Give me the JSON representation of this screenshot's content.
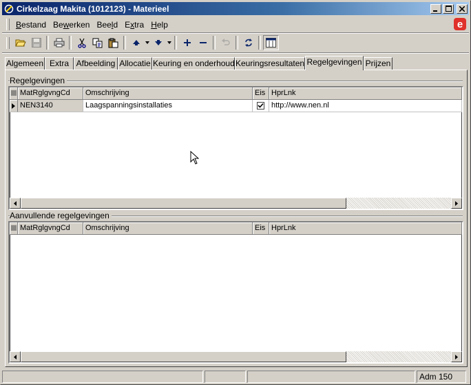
{
  "window": {
    "title": "Cirkelzaag Makita (1012123) - Materieel",
    "controls": {
      "minimize": "_",
      "maximize": "□",
      "close": "×"
    }
  },
  "menu": {
    "items": [
      {
        "label": "Bestand",
        "accel": "B"
      },
      {
        "label": "Bewerken",
        "accel": "w"
      },
      {
        "label": "Beeld",
        "accel": "l"
      },
      {
        "label": "Extra",
        "accel": "x"
      },
      {
        "label": "Help",
        "accel": "H"
      }
    ],
    "brand_glyph": "e"
  },
  "toolbar": {
    "buttons": [
      "open-folder-icon",
      "save-icon",
      "print-icon",
      "cut-icon",
      "copy-icon",
      "paste-icon",
      "navigate-up-icon",
      "navigate-down-icon",
      "add-icon",
      "remove-icon",
      "undo-icon",
      "refresh-icon",
      "layout-icon"
    ]
  },
  "tabs": {
    "items": [
      "Algemeen",
      "Extra",
      "Afbeelding",
      "Allocatie",
      "Keuring en onderhoud",
      "Keuringsresultaten",
      "Regelgevingen",
      "Prijzen"
    ],
    "active": "Regelgevingen"
  },
  "regelgevingen": {
    "title": "Regelgevingen",
    "columns": [
      "MatRglgvngCd",
      "Omschrijving",
      "Eis",
      "HprLnk"
    ],
    "rows": [
      {
        "code": "NEN3140",
        "omschrijving": "Laagspanningsinstallaties",
        "eis": true,
        "link": "http://www.nen.nl"
      }
    ]
  },
  "aanvullende": {
    "title": "Aanvullende regelgevingen",
    "columns": [
      "MatRglgvngCd",
      "Omschrijving",
      "Eis",
      "HprLnk"
    ],
    "rows": []
  },
  "statusbar": {
    "panels": [
      "",
      "",
      "",
      "Adm 150"
    ]
  },
  "colors": {
    "titlebar_start": "#0a246a",
    "titlebar_end": "#a6caf0",
    "face": "#d4d0c8",
    "brand": "#e0302a"
  }
}
